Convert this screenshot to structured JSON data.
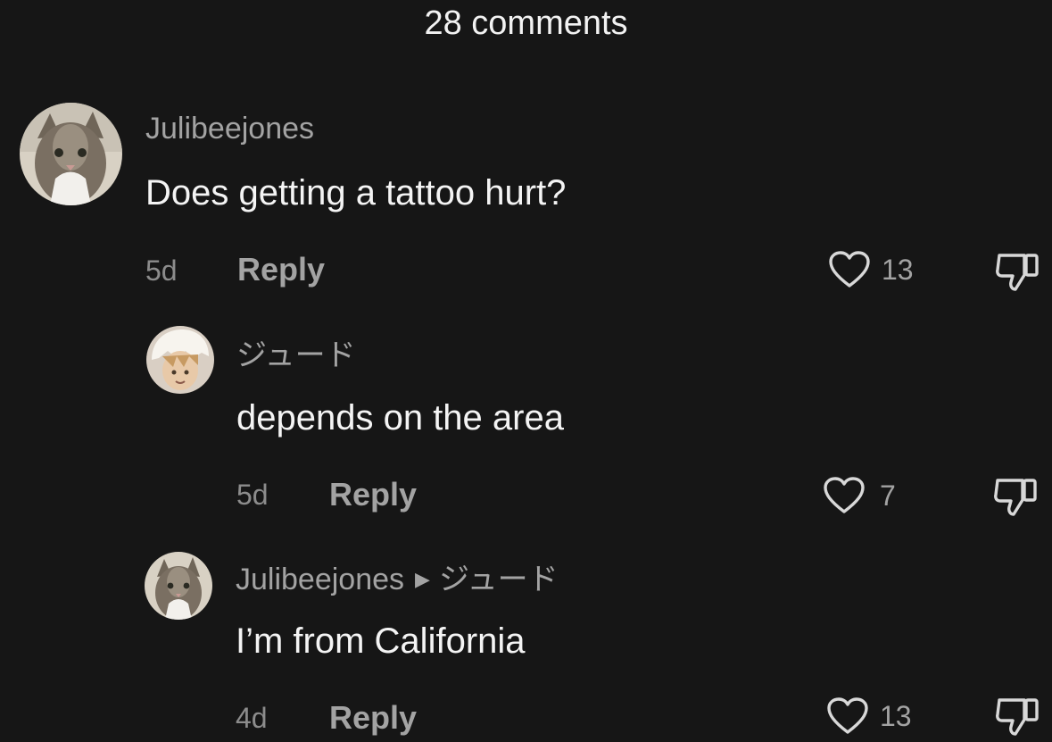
{
  "header": {
    "comment_count_label": "28 comments"
  },
  "comments": [
    {
      "username": "Julibeejones",
      "text": "Does getting a tattoo hurt?",
      "age": "5d",
      "reply_label": "Reply",
      "likes": "13",
      "avatar_icon": "cat-avatar"
    },
    {
      "username": "ジュード",
      "text": "depends on the area",
      "age": "5d",
      "reply_label": "Reply",
      "likes": "7",
      "avatar_icon": "anime-character-avatar"
    },
    {
      "username": "Julibeejones",
      "reply_to": "ジュード",
      "text": "I’m from California",
      "age": "4d",
      "reply_label": "Reply",
      "likes": "13",
      "avatar_icon": "cat-avatar"
    }
  ],
  "icons": {
    "like": "heart-icon",
    "dislike": "thumbs-down-icon",
    "reply_arrow": "right-triangle-icon"
  },
  "colors": {
    "background": "#161616",
    "primary_text": "#f2f2f2",
    "secondary_text": "#a3a3a3"
  }
}
